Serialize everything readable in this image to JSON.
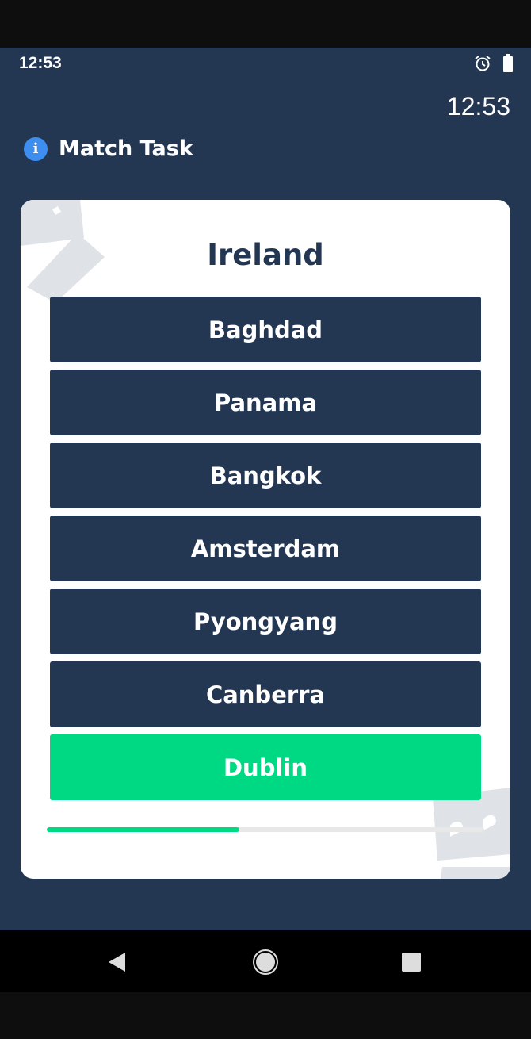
{
  "status_bar": {
    "time": "12:53",
    "icons": [
      "alarm-icon",
      "battery-icon"
    ]
  },
  "clock": "12:53",
  "header": {
    "icon": "info-icon",
    "title": "Match Task"
  },
  "question": "Ireland",
  "options": [
    {
      "label": "Baghdad",
      "state": "default"
    },
    {
      "label": "Panama",
      "state": "default"
    },
    {
      "label": "Bangkok",
      "state": "default"
    },
    {
      "label": "Amsterdam",
      "state": "default"
    },
    {
      "label": "Pyongyang",
      "state": "default"
    },
    {
      "label": "Canberra",
      "state": "default"
    },
    {
      "label": "Dublin",
      "state": "correct"
    }
  ],
  "progress": 0.44,
  "colors": {
    "background": "#233753",
    "option": "#233753",
    "correct": "#00d984",
    "info_icon": "#3e8ef0"
  },
  "nav": {
    "back": "back-icon",
    "home": "home-icon",
    "recents": "recents-icon"
  }
}
